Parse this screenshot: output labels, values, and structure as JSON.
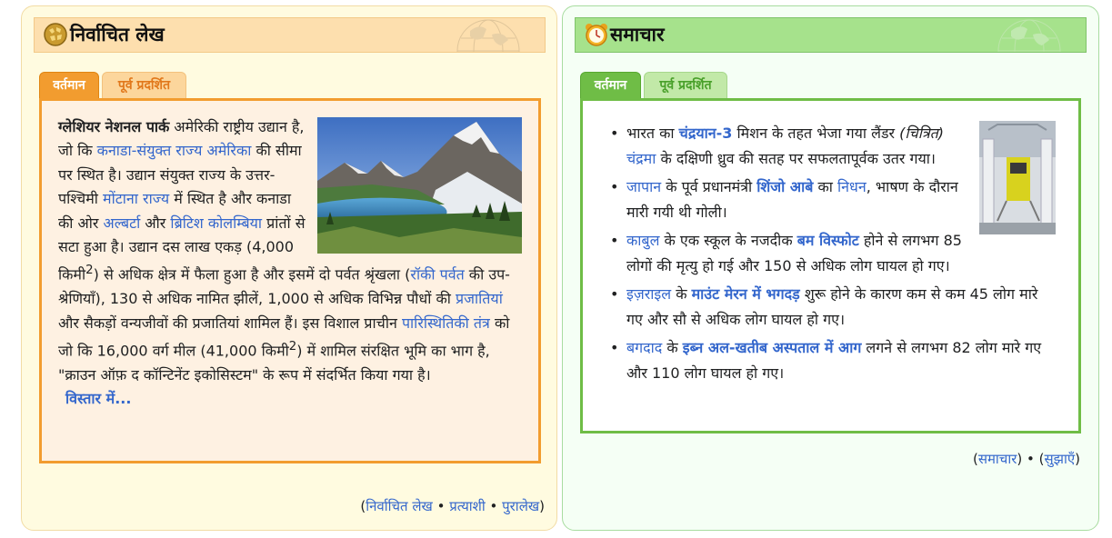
{
  "featured": {
    "title": "निर्वाचित लेख",
    "tabs": {
      "current": "वर्तमान",
      "previous": "पूर्व प्रदर्शित"
    },
    "article": {
      "subject": "ग्लेशियर नेशनल पार्क",
      "t1": " अमेरिकी राष्ट्रीय उद्यान है, जो कि ",
      "l1": "कनाडा-संयुक्त राज्य अमेरिका",
      "t2": " की सीमा पर स्थित है। उद्यान संयुक्त राज्य के उत्तर-पश्चिमी ",
      "l2": "मोंटाना राज्य",
      "t3": " में स्थित है और कनाडा की ओर ",
      "l3": "अल्बर्टा",
      "t4": " और ",
      "l4": "ब्रिटिश कोलम्बिया",
      "t5": " प्रांतों से सटा हुआ है। उद्यान दस लाख एकड़ (4,000 किमी",
      "sup1": "2",
      "t6": ") से अधिक क्षेत्र में फैला हुआ है और इसमें दो पर्वत श्रृंखला (",
      "l5": "रॉकी पर्वत",
      "t7": " की उप-श्रेणियाँ), 130 से अधिक नामित झीलें, 1,000 से अधिक विभिन्न पौधों की ",
      "l6": "प्रजातियां",
      "t8": " और सैकड़ों वन्यजीवों की प्रजातियां शामिल हैं। इस विशाल प्राचीन ",
      "l7": "पारिस्थितिकी तंत्र",
      "t9": " को जो कि 16,000 वर्ग मील (41,000 किमी",
      "sup2": "2",
      "t10": ") में शामिल संरक्षित भूमि का भाग है, \"क्राउन ऑफ़ द कॉन्टिनेंट इकोसिस्टम\" के रूप में संदर्भित किया गया है।",
      "more": "विस्तार में..."
    },
    "footer": {
      "open": "(",
      "link1": "निर्वाचित लेख",
      "sep": " • ",
      "link2": "प्रत्याशी",
      "link3": "पुरालेख",
      "close": ")"
    }
  },
  "news": {
    "title": "समाचार",
    "tabs": {
      "current": "वर्तमान",
      "previous": "पूर्व प्रदर्शित"
    },
    "bullet": "•",
    "items": [
      {
        "a": "भारत का ",
        "b": "चंद्रयान-3",
        "c": " मिशन के तहत भेजा गया लैंडर ",
        "d": "(चित्रित)",
        "e": " ",
        "f": "चंद्रमा",
        "g": " के दक्षिणी ध्रुव की सतह पर सफलतापूर्वक उतर गया।"
      },
      {
        "a": "जापान",
        "b": " के पूर्व प्रधानमंत्री ",
        "c": "शिंजो आबे",
        "d": " का ",
        "e": "निधन",
        "f": ", भाषण के दौरान मारी गयी थी गोली।"
      },
      {
        "a": "काबुल",
        "b": " के एक स्कूल के नजदीक ",
        "c": "बम विस्फोट",
        "d": " होने से लगभग 85 लोगों की मृत्यु हो गई और 150 से अधिक लोग घायल हो गए।"
      },
      {
        "a": "इज़राइल",
        "b": " के ",
        "c": "माउंट मेरन में भगदड़",
        "d": " शुरू होने के कारण कम से कम 45 लोग मारे गए और सौ से अधिक लोग घायल हो गए।"
      },
      {
        "a": "बगदाद",
        "b": " के ",
        "c": "इब्न अल-खतीब अस्पताल में आग",
        "d": " लगने से लगभग 82 लोग मारे गए और 110 लोग घायल हो गए।"
      }
    ],
    "footer": {
      "open": "(",
      "link1": "समाचार",
      "close1": ")",
      "sep": " • ",
      "open2": "(",
      "link2": "सुझाएँ",
      "close2": ")"
    }
  },
  "colors": {
    "link": "#3366cc",
    "featured_accent": "#f29c2f",
    "news_accent": "#6fbd46"
  },
  "icons": {
    "featured": "wikipedia-globe-icon",
    "news": "alarm-clock-icon"
  }
}
